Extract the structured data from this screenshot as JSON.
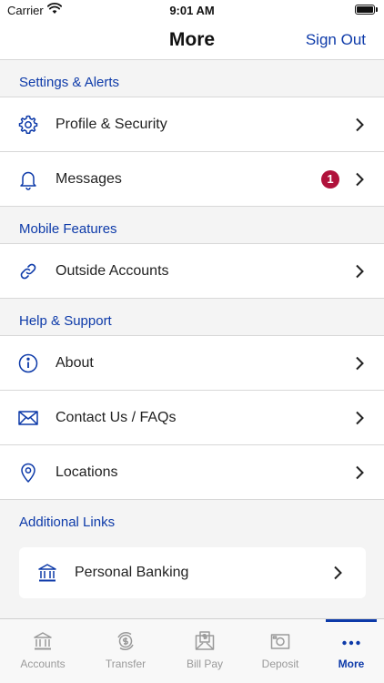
{
  "status_bar": {
    "carrier": "Carrier",
    "time": "9:01 AM"
  },
  "nav": {
    "title": "More",
    "sign_out": "Sign Out"
  },
  "sections": [
    {
      "title": "Settings & Alerts",
      "items": [
        {
          "label": "Profile & Security",
          "icon": "gear-icon"
        },
        {
          "label": "Messages",
          "icon": "bell-icon",
          "badge": "1"
        }
      ]
    },
    {
      "title": "Mobile Features",
      "items": [
        {
          "label": "Outside Accounts",
          "icon": "link-icon"
        }
      ]
    },
    {
      "title": "Help & Support",
      "items": [
        {
          "label": "About",
          "icon": "info-icon"
        },
        {
          "label": "Contact Us / FAQs",
          "icon": "envelope-icon"
        },
        {
          "label": "Locations",
          "icon": "map-pin-icon"
        }
      ]
    },
    {
      "title": "Additional Links",
      "items": [
        {
          "label": "Personal Banking",
          "icon": "bank-icon"
        }
      ]
    }
  ],
  "tabs": [
    {
      "label": "Accounts",
      "icon": "bank-icon",
      "active": false
    },
    {
      "label": "Transfer",
      "icon": "transfer-dollar-icon",
      "active": false
    },
    {
      "label": "Bill Pay",
      "icon": "bill-envelope-icon",
      "active": false
    },
    {
      "label": "Deposit",
      "icon": "camera-icon",
      "active": false
    },
    {
      "label": "More",
      "icon": "more-dots-icon",
      "active": true
    }
  ],
  "colors": {
    "accent": "#0d3aa9",
    "badge": "#b0123b",
    "icon": "#0d3aa9",
    "inactive_tab": "#9a9a9a"
  }
}
